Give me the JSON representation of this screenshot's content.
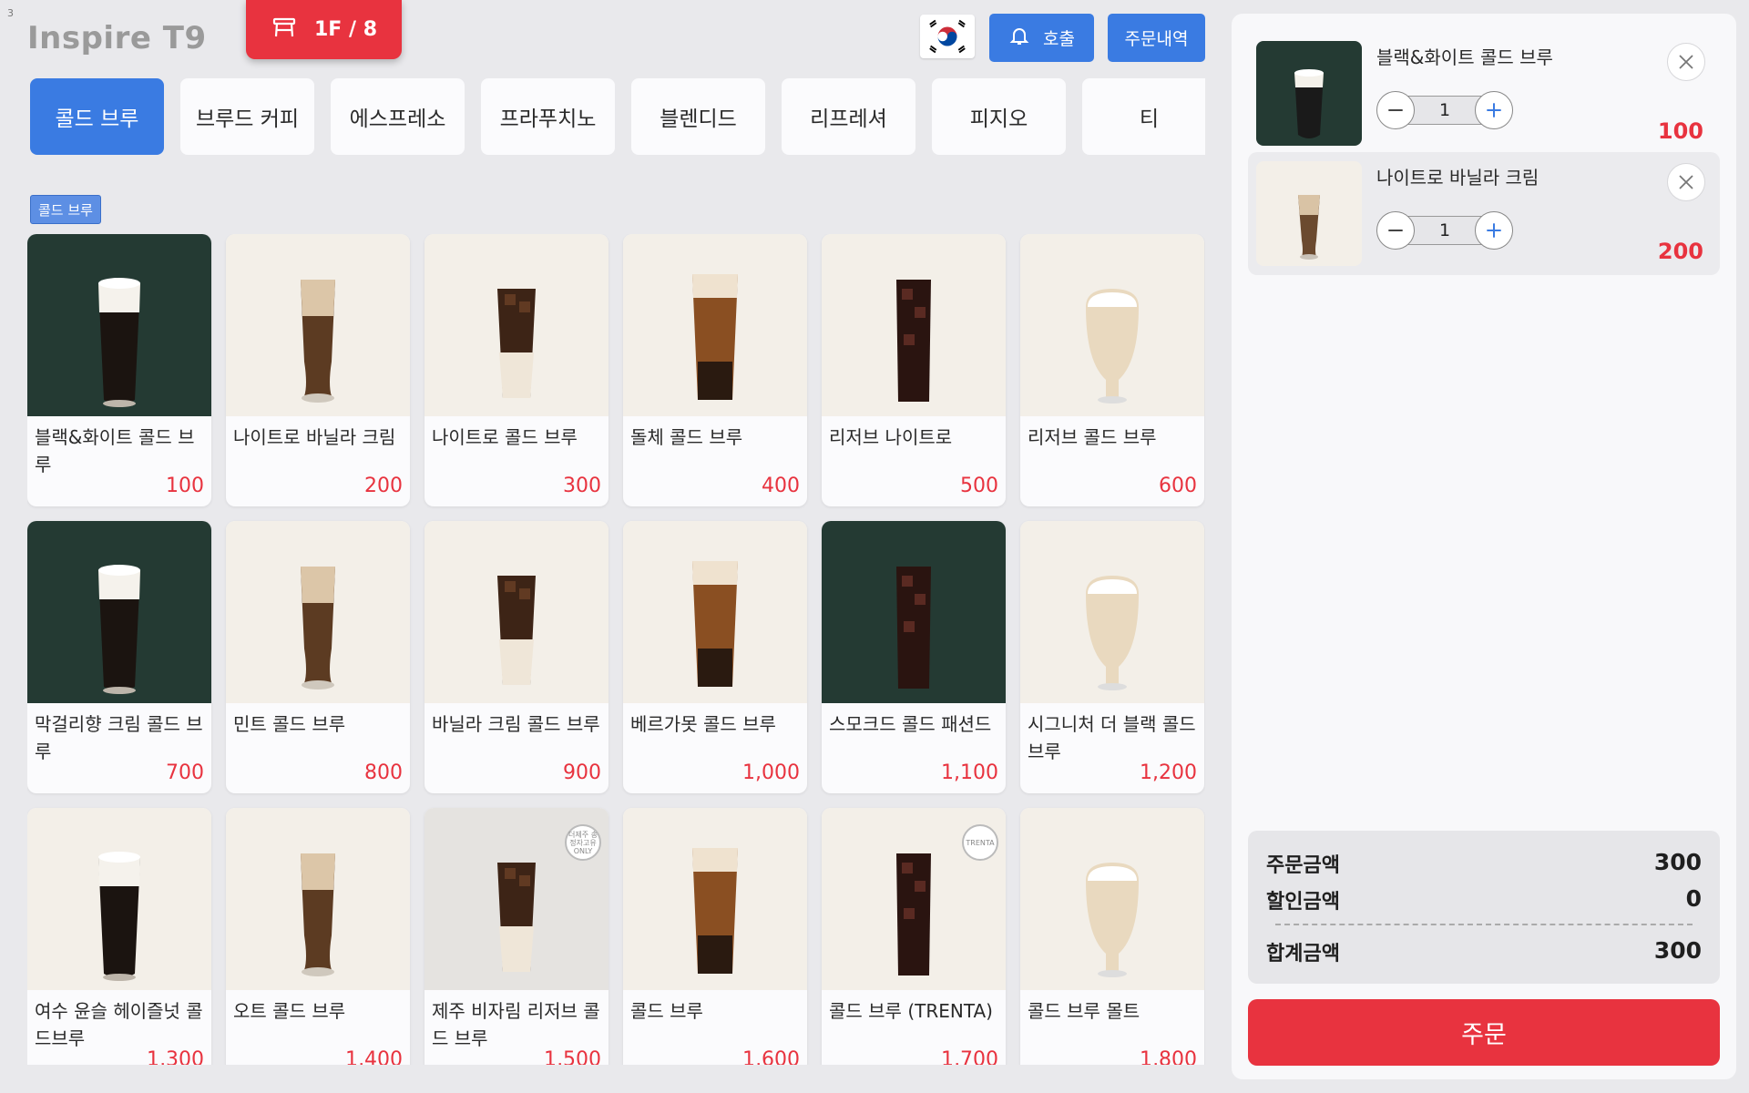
{
  "screen_number": "3",
  "brand": "Inspire T9",
  "table": {
    "label": "1F / 8"
  },
  "header": {
    "call_label": "호출",
    "orders_label": "주문내역"
  },
  "tabs": [
    {
      "label": "콜드 브루",
      "active": true
    },
    {
      "label": "브루드 커피"
    },
    {
      "label": "에스프레소"
    },
    {
      "label": "프라푸치노"
    },
    {
      "label": "블렌디드"
    },
    {
      "label": "리프레셔"
    },
    {
      "label": "피지오"
    },
    {
      "label": "티"
    }
  ],
  "section_label": "콜드 브루",
  "menu": [
    {
      "name": "블랙&화이트 콜드 브루",
      "price": "100",
      "bg": "dark"
    },
    {
      "name": "나이트로 바닐라 크림",
      "price": "200",
      "bg": "light"
    },
    {
      "name": "나이트로 콜드 브루",
      "price": "300",
      "bg": "light"
    },
    {
      "name": "돌체 콜드 브루",
      "price": "400",
      "bg": "light"
    },
    {
      "name": "리저브 나이트로",
      "price": "500",
      "bg": "light"
    },
    {
      "name": "리저브 콜드 브루",
      "price": "600",
      "bg": "light"
    },
    {
      "name": "막걸리향 크림 콜드 브루",
      "price": "700",
      "bg": "dark"
    },
    {
      "name": "민트 콜드 브루",
      "price": "800",
      "bg": "light"
    },
    {
      "name": "바닐라 크림 콜드 브루",
      "price": "900",
      "bg": "light"
    },
    {
      "name": "베르가못 콜드 브루",
      "price": "1,000",
      "bg": "light"
    },
    {
      "name": "스모크드 콜드 패션드",
      "price": "1,100",
      "bg": "dark"
    },
    {
      "name": "시그니처 더 블랙 콜드 브루",
      "price": "1,200",
      "bg": "light"
    },
    {
      "name": "여수 윤슬 헤이즐넛 콜드브루",
      "price": "1,300",
      "bg": "light"
    },
    {
      "name": "오트 콜드 브루",
      "price": "1,400",
      "bg": "light"
    },
    {
      "name": "제주 비자림 리저브 콜드 브루",
      "price": "1,500",
      "bg": "gray",
      "stamp": "더제주 송정자고유 ONLY"
    },
    {
      "name": "콜드 브루",
      "price": "1,600",
      "bg": "light"
    },
    {
      "name": "콜드 브루 (TRENTA)",
      "price": "1,700",
      "bg": "light",
      "stamp": "TRENTA"
    },
    {
      "name": "콜드 브루 몰트",
      "price": "1,800",
      "bg": "light"
    }
  ],
  "cart": {
    "items": [
      {
        "name": "블랙&화이트 콜드 브루",
        "qty": "1",
        "price": "100",
        "thumb": "dark"
      },
      {
        "name": "나이트로 바닐라 크림",
        "qty": "1",
        "price": "200",
        "thumb": "light"
      }
    ],
    "summary": {
      "order_amount_label": "주문금액",
      "order_amount": "300",
      "discount_label": "할인금액",
      "discount": "0",
      "total_label": "합계금액",
      "total": "300"
    },
    "order_button": "주문"
  },
  "colors": {
    "accent": "#3a7be2",
    "danger": "#e8333f",
    "background": "#e9e9ec"
  }
}
